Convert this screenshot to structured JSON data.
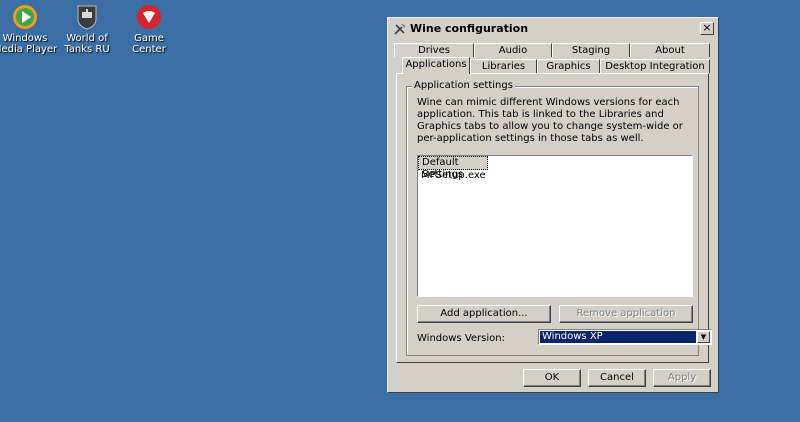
{
  "desktop": {
    "icons": [
      {
        "label": "Windows Media Player",
        "icon": "media-player-icon"
      },
      {
        "label": "World of Tanks RU",
        "icon": "tank-icon"
      },
      {
        "label": "Game Center",
        "icon": "game-center-icon"
      }
    ]
  },
  "window": {
    "title": "Wine configuration",
    "close_label": "×",
    "tabs_row1": [
      "Drives",
      "Audio",
      "Staging",
      "About"
    ],
    "tabs_row2": [
      "Applications",
      "Libraries",
      "Graphics",
      "Desktop Integration"
    ],
    "active_tab": "Applications",
    "group_title": "Application settings",
    "description": "Wine can mimic different Windows versions for each application. This tab is linked to the Libraries and Graphics tabs to allow you to change system-wide or per-application settings in those tabs as well.",
    "apps": [
      "Default Settings",
      "MPSetup.exe"
    ],
    "add_button": "Add application...",
    "remove_button": "Remove application",
    "version_label": "Windows Version:",
    "version_value": "Windows XP",
    "ok": "OK",
    "cancel": "Cancel",
    "apply": "Apply"
  },
  "colors": {
    "desktop": "#3a6ea5",
    "window": "#d4d0c8",
    "selection": "#0a246a"
  }
}
